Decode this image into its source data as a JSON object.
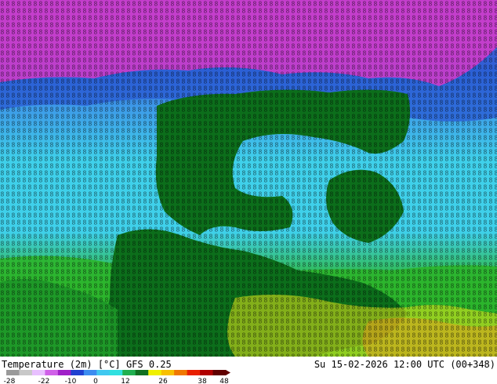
{
  "map": {
    "field_label": "Temperature (2m) [°C]",
    "model": "GFS 0.25",
    "valid_time": "Su 15-02-2026 12:00 UTC (00+348)",
    "colorbar": {
      "ticks": [
        "-28",
        "-22",
        "-10",
        "0",
        "12",
        "26",
        "38",
        "48"
      ],
      "colors": [
        "#9a9a9a",
        "#c8c8c8",
        "#e8c0ff",
        "#d060e8",
        "#a020c8",
        "#2040d0",
        "#3c8cf0",
        "#40c8f0",
        "#30e0e0",
        "#20b050",
        "#107020",
        "#f0f000",
        "#f8c000",
        "#f07800",
        "#e82000",
        "#b00000",
        "#600000"
      ]
    },
    "palette": {
      "polar_magenta": "#c43ecb",
      "cold_blue": "#2b63d6",
      "mid_blue": "#3d9ae8",
      "cyan": "#3fd0ea",
      "land_green": "#0c6e1b",
      "light_green": "#2cb52c",
      "yellow": "#e6e61a",
      "orange": "#f29a1a"
    }
  }
}
